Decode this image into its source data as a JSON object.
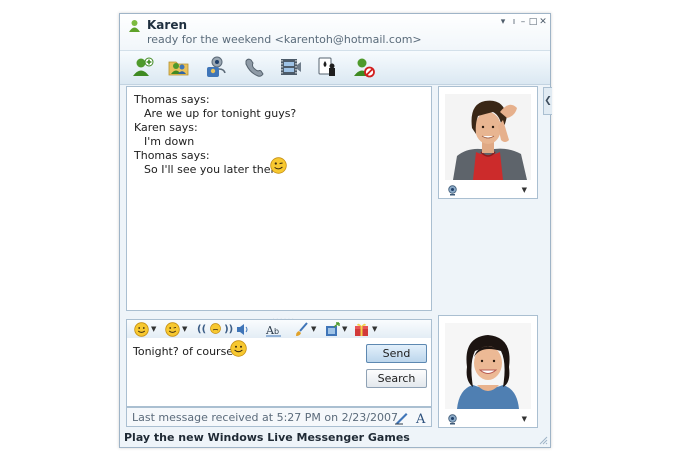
{
  "window": {
    "contact_name": "Karen",
    "contact_status": "ready for the weekend <karentoh@hotmail.com>",
    "controls": {
      "menu": "▾",
      "pin": "ı",
      "minimize": "–",
      "maximize": "□",
      "close": "✕"
    }
  },
  "toolbar": {
    "items": [
      {
        "name": "invite-contact",
        "icon": "add-contact-icon"
      },
      {
        "name": "share-folder",
        "icon": "shared-folder-icon"
      },
      {
        "name": "video-call",
        "icon": "video-call-icon"
      },
      {
        "name": "voice-call",
        "icon": "phone-icon"
      },
      {
        "name": "activities",
        "icon": "filmstrip-icon"
      },
      {
        "name": "games",
        "icon": "games-icon"
      },
      {
        "name": "block-contact",
        "icon": "block-contact-icon"
      }
    ]
  },
  "conversation": {
    "messages": [
      {
        "sender": "Thomas says:",
        "text": "Are we up for tonight guys?"
      },
      {
        "sender": "Karen says:",
        "text": "I'm down"
      },
      {
        "sender": "Thomas says:",
        "text": "So I'll see you later then",
        "emoticon": "wink-emoticon"
      }
    ]
  },
  "resize_grip": "......",
  "format_bar": {
    "items": [
      "emoticon-menu",
      "wink-menu",
      "nudge",
      "voice-clip",
      "font",
      "background",
      "send-file",
      "gift"
    ],
    "nudge_label": "((",
    "nudge_label_end": "))"
  },
  "compose": {
    "text": "Tonight? of course!",
    "send_label": "Send",
    "search_label": "Search"
  },
  "status_bar": {
    "text": "Last message received at 5:27 PM on 2/23/2007."
  },
  "banner": "Play the new Windows Live Messenger Games",
  "colors": {
    "window_border": "#9fb4c7",
    "panel_border": "#aabfd1",
    "send_button": "#c8def0",
    "contact_shirt": "#cc2b2b"
  }
}
